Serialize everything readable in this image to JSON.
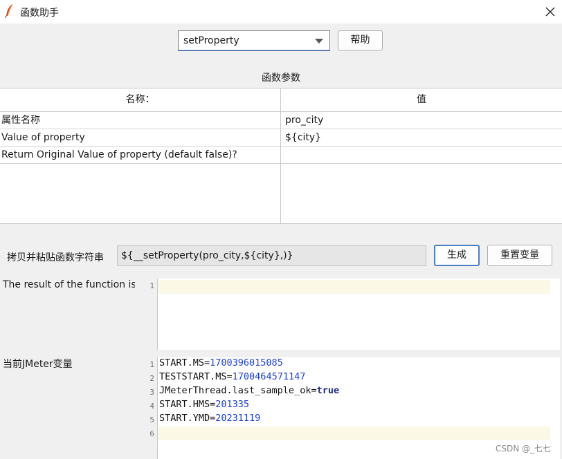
{
  "window": {
    "title": "函数助手",
    "close_label": "×"
  },
  "function_selector": {
    "selected": "setProperty",
    "help_label": "帮助"
  },
  "parameters": {
    "heading": "函数参数",
    "columns": [
      "名称：",
      "值"
    ],
    "rows": [
      {
        "name": "属性名称",
        "value": "pro_city"
      },
      {
        "name": "Value of property",
        "value": "${city}"
      },
      {
        "name": "Return Original Value of property (default false)?",
        "value": ""
      }
    ]
  },
  "copy_paste": {
    "label": "拷贝并粘贴函数字符串",
    "value": "${__setProperty(pro_city,${city},)}",
    "generate_label": "生成",
    "reset_label": "重置变量"
  },
  "result": {
    "label": "The result of the function is",
    "line_numbers": [
      "1"
    ]
  },
  "variables": {
    "label": "当前JMeter变量",
    "line_numbers": [
      "1",
      "2",
      "3",
      "4",
      "5",
      "6"
    ],
    "lines": [
      {
        "key": "START.MS=",
        "value": "1700396015085"
      },
      {
        "key": "TESTSTART.MS=",
        "value": "1700464571147"
      },
      {
        "key": "JMeterThread.last_sample_ok=",
        "value": "true"
      },
      {
        "key": "START.HMS=",
        "value": "201335"
      },
      {
        "key": "START.YMD=",
        "value": "20231119"
      }
    ]
  },
  "watermark": "CSDN @_七七",
  "icons": {
    "app": "feather-icon",
    "close": "close-icon",
    "dropdown": "chevron-down-icon"
  },
  "colors": {
    "accent": "#4a7fc1",
    "number": "#1c3fd1",
    "keyword": "#1c2a85",
    "current_line": "#fbf8e6"
  }
}
